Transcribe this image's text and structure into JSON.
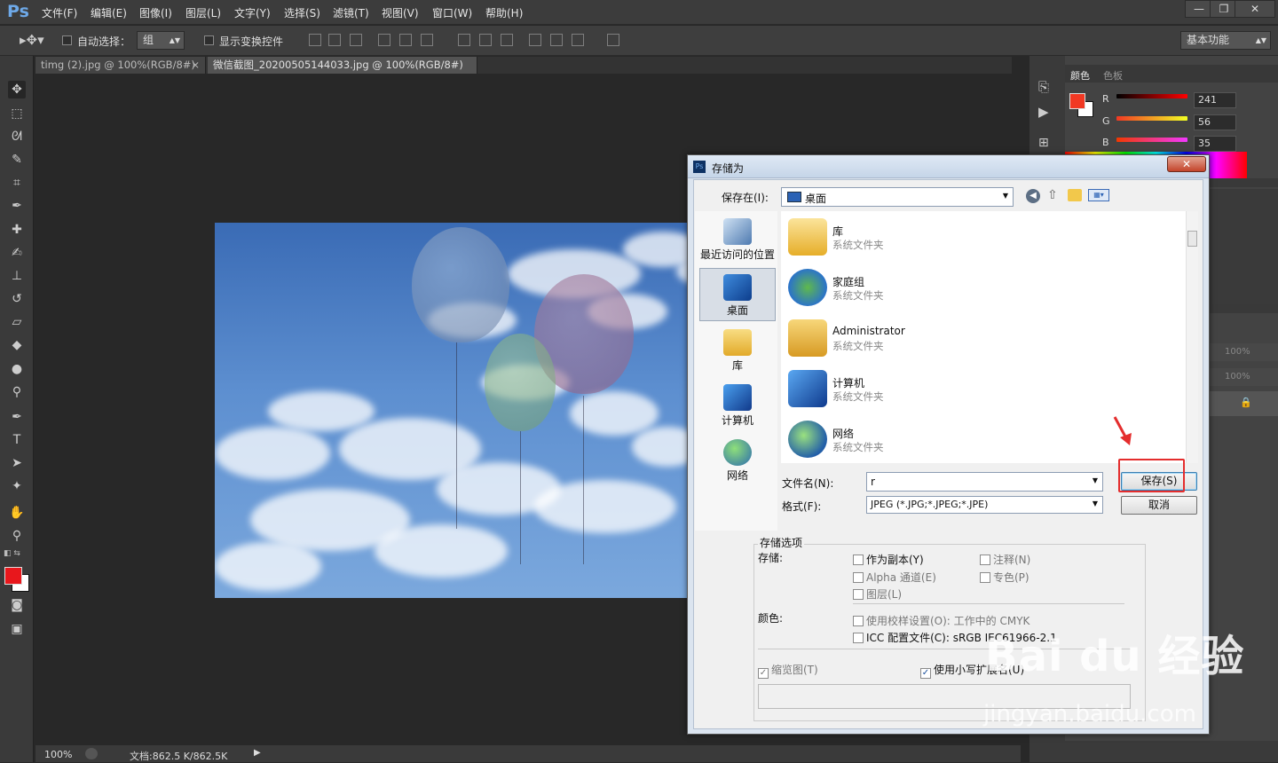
{
  "app": {
    "logo": "Ps"
  },
  "menu": [
    "文件(F)",
    "编辑(E)",
    "图像(I)",
    "图层(L)",
    "文字(Y)",
    "选择(S)",
    "滤镜(T)",
    "视图(V)",
    "窗口(W)",
    "帮助(H)"
  ],
  "window_buttons": [
    "—",
    "❐",
    "✕"
  ],
  "options": {
    "auto_select_label": "自动选择：",
    "auto_select_value": "组",
    "show_transform_label": "显示变换控件",
    "workspace": "基本功能"
  },
  "tabs": [
    {
      "label": "timg (2).jpg @ 100%(RGB/8#)",
      "close": "×"
    },
    {
      "label": "微信截图_20200505144033.jpg @ 100%(RGB/8#) *",
      "close": "×"
    }
  ],
  "status": {
    "zoom": "100%",
    "doc": "文档:862.5 K/862.5K"
  },
  "color_panel": {
    "tabs": [
      "颜色",
      "色板"
    ],
    "channels": [
      {
        "label": "R",
        "value": "241"
      },
      {
        "label": "G",
        "value": "56"
      },
      {
        "label": "B",
        "value": "35"
      }
    ],
    "foreground": "#f13823",
    "layers_opacity": "100%",
    "layers_fill": "100%"
  },
  "dialog": {
    "title": "存储为",
    "save_in_label": "保存在(I):",
    "save_in_value": "桌面",
    "places": [
      "最近访问的位置",
      "桌面",
      "库",
      "计算机",
      "网络"
    ],
    "files": [
      {
        "name": "库",
        "type": "系统文件夹"
      },
      {
        "name": "家庭组",
        "type": "系统文件夹"
      },
      {
        "name": "Administrator",
        "type": "系统文件夹"
      },
      {
        "name": "计算机",
        "type": "系统文件夹"
      },
      {
        "name": "网络",
        "type": "系统文件夹"
      }
    ],
    "filename_label": "文件名(N):",
    "filename_value": "r",
    "format_label": "格式(F):",
    "format_value": "JPEG (*.JPG;*.JPEG;*.JPE)",
    "save_button": "保存(S)",
    "cancel_button": "取消",
    "options_title": "存储选项",
    "store_label": "存储:",
    "opt_copy": "作为副本(Y)",
    "opt_notes": "注释(N)",
    "opt_alpha": "Alpha 通道(E)",
    "opt_spot": "专色(P)",
    "opt_layers": "图层(L)",
    "color_label": "颜色:",
    "opt_proof": "使用校样设置(O): 工作中的 CMYK",
    "opt_icc": "ICC 配置文件(C): sRGB IEC61966-2.1",
    "opt_thumb": "缩览图(T)",
    "opt_lower": "使用小写扩展名(U)"
  },
  "watermark": {
    "main": "Bai du 经验",
    "sub": "jingyan.baidu.com"
  }
}
